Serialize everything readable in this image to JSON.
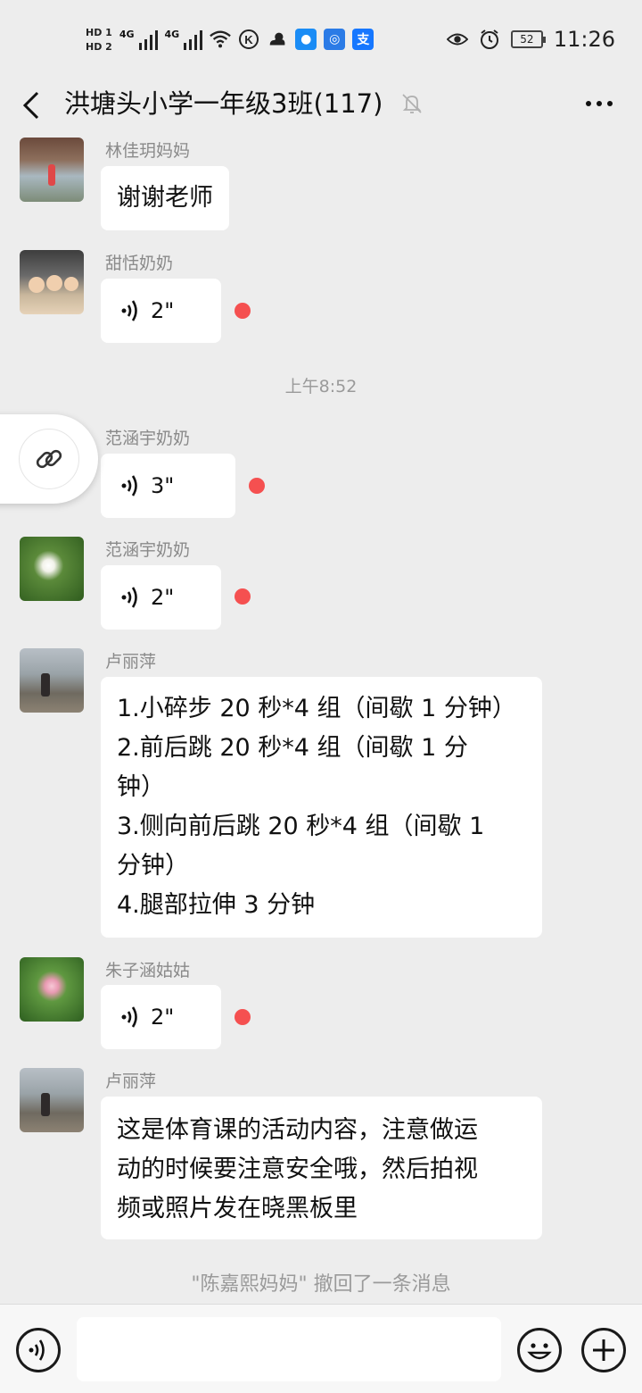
{
  "status_bar": {
    "hd1": "HD 1",
    "hd2": "HD 2",
    "network1": "4G",
    "network2": "4G",
    "battery": "52",
    "time": "11:26"
  },
  "header": {
    "title": "洪塘头小学一年级3班(117)",
    "back_icon": "chevron-left-icon",
    "mute_icon": "bell-muted-icon",
    "more_icon": "more-dots-icon"
  },
  "messages": [
    {
      "sender": "林佳玥妈妈",
      "type": "text",
      "lines": [
        "谢谢老师"
      ]
    },
    {
      "sender": "甜恬奶奶",
      "type": "voice",
      "duration": "2\""
    },
    {
      "sender": "范涵宇奶奶",
      "type": "voice",
      "duration": "3\""
    },
    {
      "sender": "范涵宇奶奶",
      "type": "voice",
      "duration": "2\""
    },
    {
      "sender": "卢丽萍",
      "type": "text",
      "lines": [
        "1.小碎步   20 秒*4 组（间歇 1 分钟）",
        "2.前后跳    20 秒*4 组（间歇 1 分",
        "钟）",
        "3.侧向前后跳    20 秒*4 组（间歇 1",
        "分钟）",
        "4.腿部拉伸    3 分钟"
      ]
    },
    {
      "sender": "朱子涵姑姑",
      "type": "voice",
      "duration": "2\""
    },
    {
      "sender": "卢丽萍",
      "type": "text",
      "lines": [
        "这是体育课的活动内容，注意做运",
        "动的时候要注意安全哦，然后拍视",
        "频或照片发在晓黑板里"
      ]
    }
  ],
  "timestamp": "上午8:52",
  "system_notice": "\"陈嘉熙妈妈\" 撤回了一条消息",
  "input_bar": {
    "voice_icon": "voice-toggle-icon",
    "input_value": "",
    "emoji_icon": "emoji-icon",
    "plus_icon": "plus-icon"
  },
  "colors": {
    "background": "#ededed",
    "bubble": "#ffffff",
    "unread_dot": "#f55050",
    "sender_name": "#8a8a8a"
  }
}
